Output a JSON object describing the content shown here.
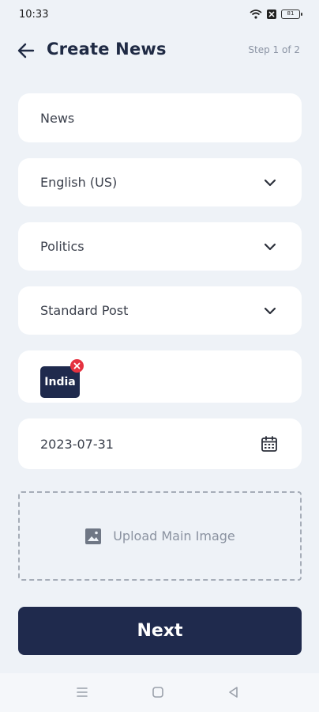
{
  "status_bar": {
    "time": "10:33",
    "battery": "81"
  },
  "header": {
    "title": "Create News",
    "step": "Step 1 of 2"
  },
  "form": {
    "category_type": "News",
    "language": "English (US)",
    "topic": "Politics",
    "post_type": "Standard Post",
    "tag": "India",
    "date": "2023-07-31",
    "upload_label": "Upload Main Image"
  },
  "actions": {
    "next_label": "Next"
  },
  "colors": {
    "primary": "#1f2a4d",
    "background": "#eef2f7",
    "remove": "#e53240"
  },
  "icons": [
    "back-arrow-icon",
    "chevron-down-icon",
    "close-icon",
    "calendar-icon",
    "image-icon",
    "menu-icon",
    "home-icon",
    "back-icon"
  ]
}
